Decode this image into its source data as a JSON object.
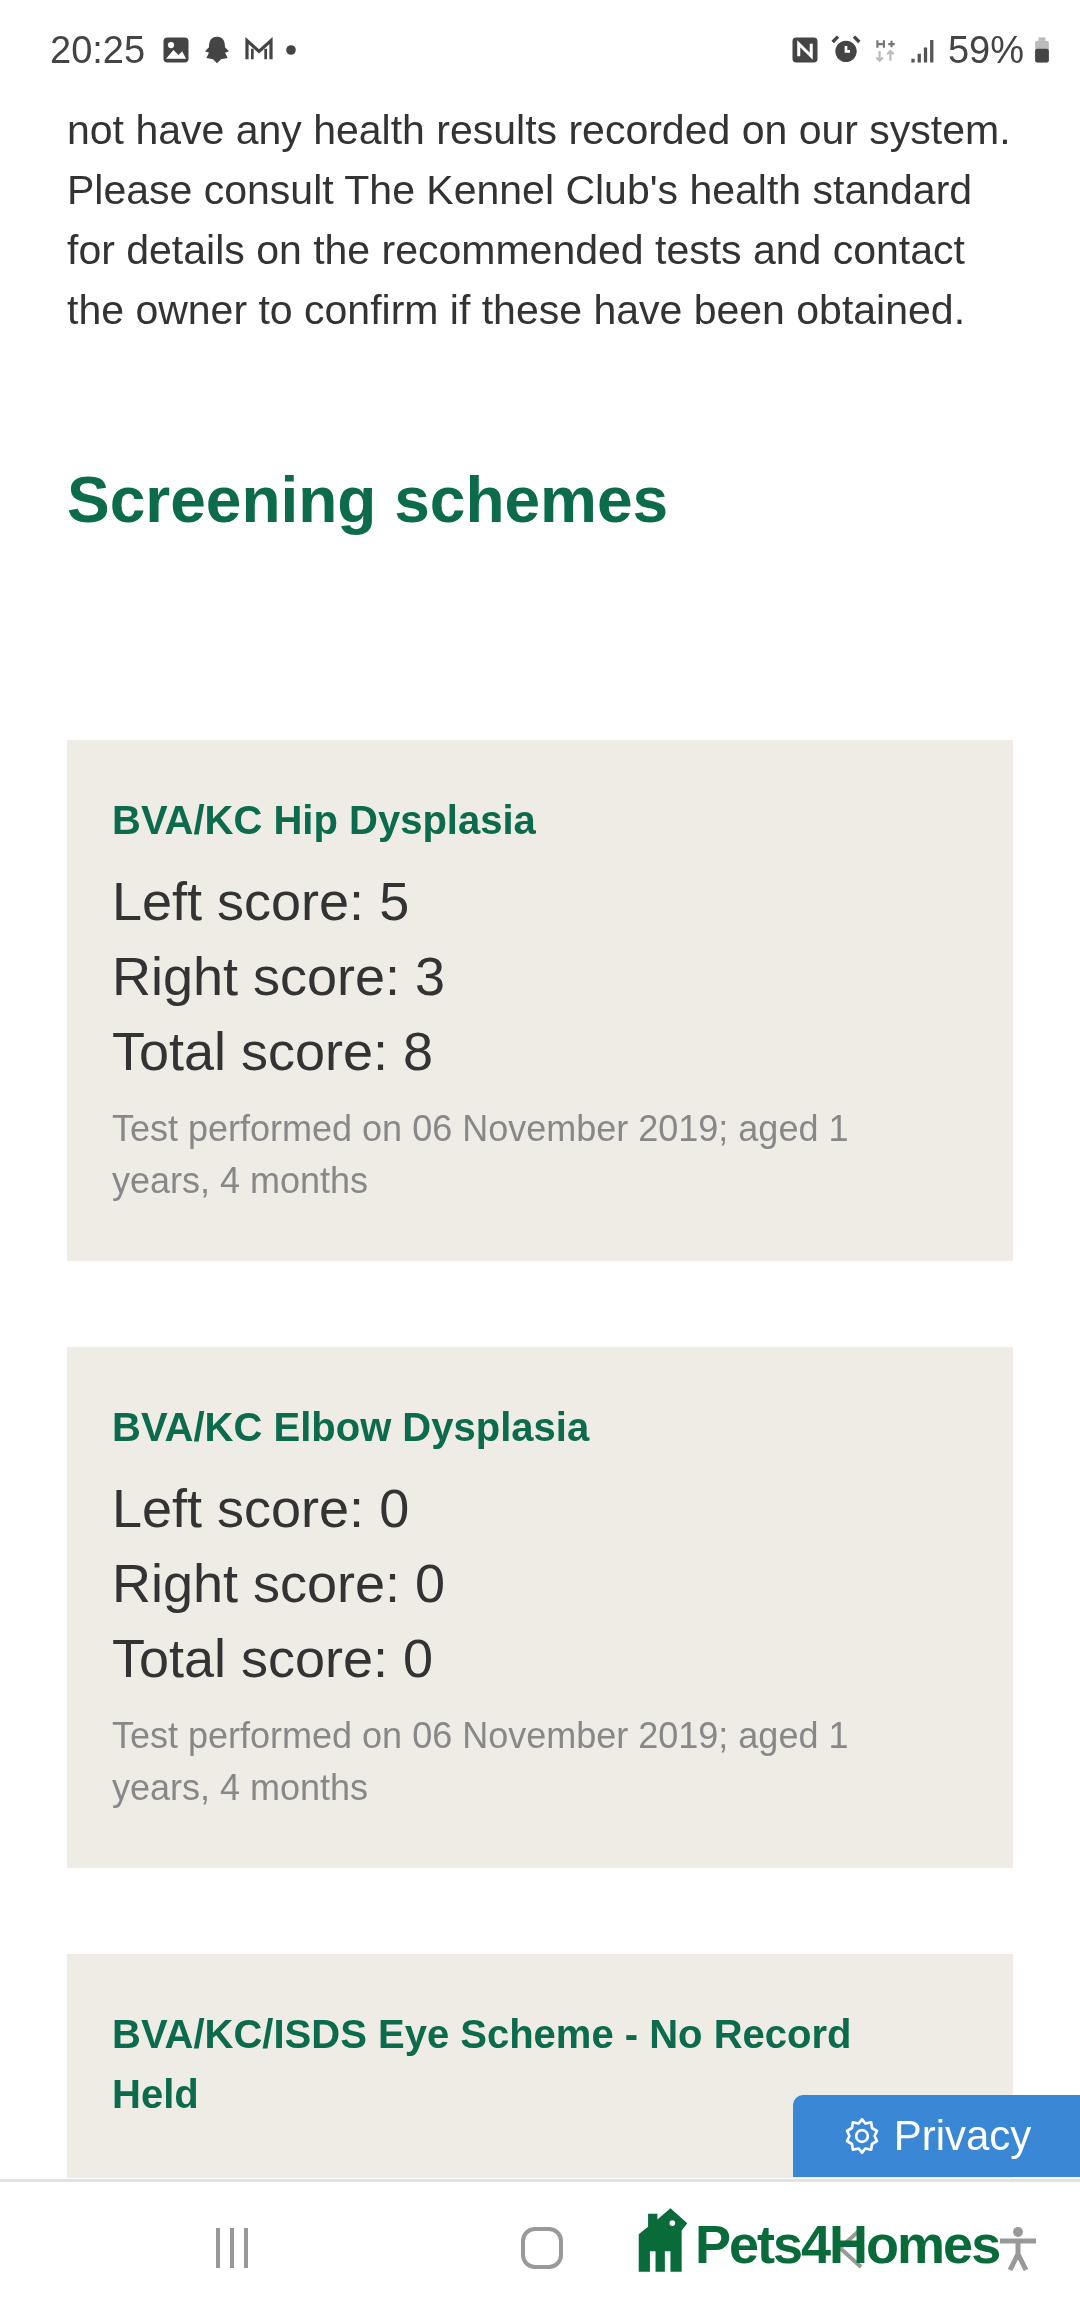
{
  "status_bar": {
    "time": "20:25",
    "battery": "59%"
  },
  "notice": "not have any health results recorded on our system. Please consult The Kennel Club's health standard for details on the recommended tests and contact the owner to confirm if these have been obtained.",
  "section_title": "Screening schemes",
  "schemes": [
    {
      "title": "BVA/KC Hip Dysplasia",
      "scores": [
        "Left score: 5",
        "Right score: 3",
        "Total score: 8"
      ],
      "note": "Test performed on 06 November 2019; aged 1 years, 4 months"
    },
    {
      "title": "BVA/KC Elbow Dysplasia",
      "scores": [
        "Left score: 0",
        "Right score: 0",
        "Total score: 0"
      ],
      "note": "Test performed on 06 November 2019; aged 1 years, 4 months"
    },
    {
      "title": "BVA/KC/ISDS Eye Scheme - No Record Held"
    }
  ],
  "privacy_button": {
    "label": "Privacy"
  },
  "logo": {
    "text": "Pets4Homes"
  }
}
